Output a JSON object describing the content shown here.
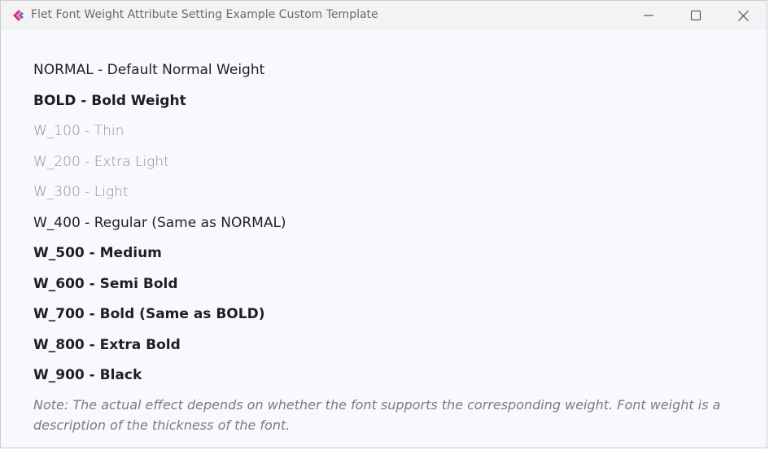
{
  "window": {
    "title": "Flet Font Weight Attribute Setting Example Custom Template"
  },
  "controls": {
    "minimize": "minimize-icon",
    "maximize": "maximize-icon",
    "close": "close-icon"
  },
  "rows": [
    {
      "text": "NORMAL - Default Normal Weight"
    },
    {
      "text": "BOLD - Bold Weight"
    },
    {
      "text": "W_100 - Thin"
    },
    {
      "text": "W_200 - Extra Light"
    },
    {
      "text": "W_300 - Light"
    },
    {
      "text": "W_400 - Regular (Same as NORMAL)"
    },
    {
      "text": "W_500 - Medium"
    },
    {
      "text": "W_600 - Semi Bold"
    },
    {
      "text": "W_700 - Bold (Same as BOLD)"
    },
    {
      "text": "W_800 - Extra Bold"
    },
    {
      "text": "W_900 - Black"
    }
  ],
  "note": "Note: The actual effect depends on whether the font supports the corresponding weight. Font weight is a description of the thickness of the font.",
  "colors": {
    "background": "#f8f9ff",
    "titlebar": "#f3f3f5",
    "text": "#1f1f23",
    "light_text": "#8e8e94",
    "note_text": "#7b7b80",
    "icon_red": "#e0306b",
    "icon_blue": "#3b6fe0"
  }
}
